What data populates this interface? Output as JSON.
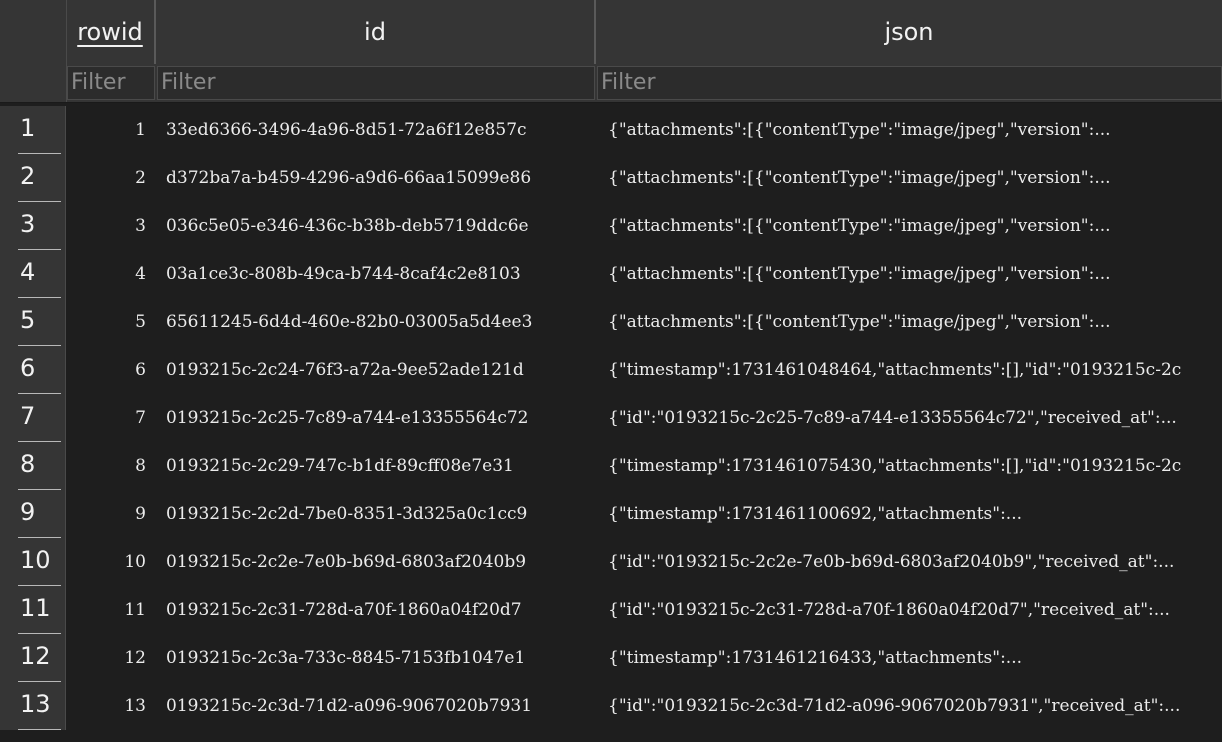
{
  "table": {
    "columns": [
      {
        "key": "rowid",
        "label": "rowid"
      },
      {
        "key": "id",
        "label": "id"
      },
      {
        "key": "json",
        "label": "json"
      }
    ],
    "filter_placeholder": "Filter",
    "rows": [
      {
        "num": "1",
        "rowid": "1",
        "id": "33ed6366-3496-4a96-8d51-72a6f12e857c",
        "json": "{\"attachments\":[{\"contentType\":\"image/jpeg\",\"version\":..."
      },
      {
        "num": "2",
        "rowid": "2",
        "id": "d372ba7a-b459-4296-a9d6-66aa15099e86",
        "json": "{\"attachments\":[{\"contentType\":\"image/jpeg\",\"version\":..."
      },
      {
        "num": "3",
        "rowid": "3",
        "id": "036c5e05-e346-436c-b38b-deb5719ddc6e",
        "json": "{\"attachments\":[{\"contentType\":\"image/jpeg\",\"version\":..."
      },
      {
        "num": "4",
        "rowid": "4",
        "id": "03a1ce3c-808b-49ca-b744-8caf4c2e8103",
        "json": "{\"attachments\":[{\"contentType\":\"image/jpeg\",\"version\":..."
      },
      {
        "num": "5",
        "rowid": "5",
        "id": "65611245-6d4d-460e-82b0-03005a5d4ee3",
        "json": "{\"attachments\":[{\"contentType\":\"image/jpeg\",\"version\":..."
      },
      {
        "num": "6",
        "rowid": "6",
        "id": "0193215c-2c24-76f3-a72a-9ee52ade121d",
        "json": "{\"timestamp\":1731461048464,\"attachments\":[],\"id\":\"0193215c-2c"
      },
      {
        "num": "7",
        "rowid": "7",
        "id": "0193215c-2c25-7c89-a744-e13355564c72",
        "json": "{\"id\":\"0193215c-2c25-7c89-a744-e13355564c72\",\"received_at\":..."
      },
      {
        "num": "8",
        "rowid": "8",
        "id": "0193215c-2c29-747c-b1df-89cff08e7e31",
        "json": "{\"timestamp\":1731461075430,\"attachments\":[],\"id\":\"0193215c-2c"
      },
      {
        "num": "9",
        "rowid": "9",
        "id": "0193215c-2c2d-7be0-8351-3d325a0c1cc9",
        "json": "{\"timestamp\":1731461100692,\"attachments\":..."
      },
      {
        "num": "10",
        "rowid": "10",
        "id": "0193215c-2c2e-7e0b-b69d-6803af2040b9",
        "json": "{\"id\":\"0193215c-2c2e-7e0b-b69d-6803af2040b9\",\"received_at\":..."
      },
      {
        "num": "11",
        "rowid": "11",
        "id": "0193215c-2c31-728d-a70f-1860a04f20d7",
        "json": "{\"id\":\"0193215c-2c31-728d-a70f-1860a04f20d7\",\"received_at\":..."
      },
      {
        "num": "12",
        "rowid": "12",
        "id": "0193215c-2c3a-733c-8845-7153fb1047e1",
        "json": "{\"timestamp\":1731461216433,\"attachments\":..."
      },
      {
        "num": "13",
        "rowid": "13",
        "id": "0193215c-2c3d-71d2-a096-9067020b7931",
        "json": "{\"id\":\"0193215c-2c3d-71d2-a096-9067020b7931\",\"received_at\":..."
      }
    ]
  }
}
